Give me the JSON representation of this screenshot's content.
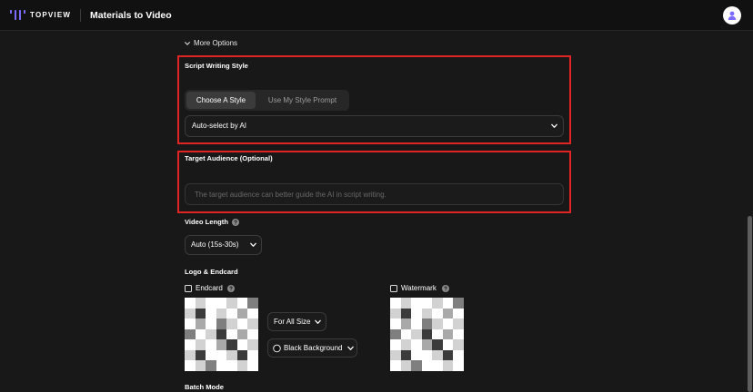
{
  "header": {
    "brand": "TOPVIEW",
    "title": "Materials to Video",
    "avatar_icon": "user-icon",
    "logo_icon": "topview-logo-icon"
  },
  "more_options": {
    "label": "More Options",
    "icon": "chevron-down-icon"
  },
  "script_style": {
    "title": "Script Writing Style",
    "tabs": [
      {
        "label": "Choose A Style",
        "active": true
      },
      {
        "label": "Use My Style Prompt",
        "active": false
      }
    ],
    "select_value": "Auto-select by AI"
  },
  "target_audience": {
    "title": "Target Audience (Optional)",
    "placeholder": "The target audience can better guide the AI in script writing."
  },
  "video_length": {
    "title": "Video Length",
    "select_value": "Auto (15s-30s)"
  },
  "logo_endcard": {
    "title": "Logo & Endcard",
    "endcard": {
      "label": "Endcard",
      "checked": false
    },
    "size_select_value": "For All Size",
    "background_select_value": "Black Background",
    "watermark": {
      "label": "Watermark",
      "checked": false
    }
  },
  "batch_mode": {
    "title": "Batch Mode"
  },
  "colors": {
    "accent": "#7b6cff",
    "highlight_border": "#e02424",
    "background": "#181818",
    "header_background": "#111111"
  }
}
